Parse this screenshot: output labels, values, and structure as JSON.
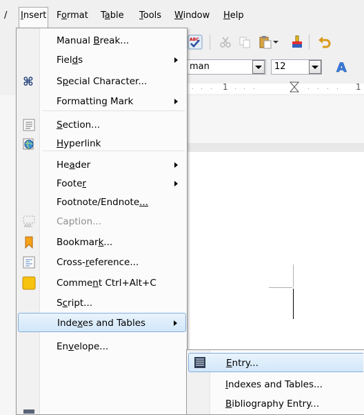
{
  "menubar": {
    "items": [
      {
        "label": "Insert",
        "mnemonic_index": 0
      },
      {
        "label": "Format",
        "mnemonic_index": 1
      },
      {
        "label": "Table",
        "mnemonic_index": 1
      },
      {
        "label": "Tools",
        "mnemonic_index": 0
      },
      {
        "label": "Window",
        "mnemonic_index": 0
      },
      {
        "label": "Help",
        "mnemonic_index": 0
      }
    ],
    "open_index": 0,
    "truncated_left_char": "/"
  },
  "toolbar": {
    "font_name": "man",
    "font_size": "12"
  },
  "ruler": {
    "labels": [
      "1",
      "1"
    ]
  },
  "insert_menu": {
    "items": [
      {
        "pre": "Manual ",
        "u": "B",
        "post": "reak...",
        "submenu": false,
        "icon": "none"
      },
      {
        "pre": "Fiel",
        "u": "d",
        "post": "s",
        "submenu": true,
        "icon": "none"
      },
      {
        "pre": "S",
        "u": "p",
        "post": "ecial Character...",
        "submenu": false,
        "icon": "command-symbol-icon"
      },
      {
        "pre": "Formattin",
        "u": "g",
        "post": " Mark",
        "submenu": true,
        "icon": "none"
      },
      {
        "pre": "",
        "u": "S",
        "post": "ection...",
        "submenu": false,
        "icon": "section-icon"
      },
      {
        "pre": "",
        "u": "H",
        "post": "yperlink",
        "submenu": false,
        "icon": "hyperlink-globe-icon"
      },
      {
        "pre": "He",
        "u": "a",
        "post": "der",
        "submenu": true,
        "icon": "none"
      },
      {
        "pre": "Foote",
        "u": "r",
        "post": "",
        "submenu": true,
        "icon": "none"
      },
      {
        "pre": "Footnote/Endnote",
        "u": "...",
        "post": "",
        "submenu": false,
        "icon": "none"
      },
      {
        "pre": "Caption...",
        "u": "",
        "post": "",
        "submenu": false,
        "icon": "caption-icon",
        "disabled": true
      },
      {
        "pre": "Bookmar",
        "u": "k",
        "post": "...",
        "submenu": false,
        "icon": "bookmark-icon"
      },
      {
        "pre": "Cross-",
        "u": "r",
        "post": "eference...",
        "submenu": false,
        "icon": "cross-reference-icon"
      },
      {
        "pre": "Comme",
        "u": "n",
        "post": "t  Ctrl+Alt+C",
        "submenu": false,
        "icon": "comment-icon"
      },
      {
        "pre": "S",
        "u": "c",
        "post": "ript...",
        "submenu": false,
        "icon": "none"
      },
      {
        "pre": "Inde",
        "u": "x",
        "post": "es and Tables",
        "submenu": true,
        "icon": "none",
        "highlighted": true
      },
      {
        "pre": "En",
        "u": "v",
        "post": "elope...",
        "submenu": false,
        "icon": "none"
      }
    ]
  },
  "submenu": {
    "items": [
      {
        "pre": "",
        "u": "E",
        "post": "ntry...",
        "icon": "index-entry-icon",
        "highlighted": true
      },
      {
        "pre": "",
        "u": "I",
        "post": "ndexes and Tables...",
        "icon": "none"
      },
      {
        "pre": "",
        "u": "B",
        "post": "ibliography Entry...",
        "icon": "none"
      }
    ]
  },
  "colors": {
    "menu_bg": "#fbfbfb",
    "highlight_border": "#84acdd",
    "highlight_fill": "#d1e7fa",
    "disabled_text": "#8d8d8d"
  }
}
